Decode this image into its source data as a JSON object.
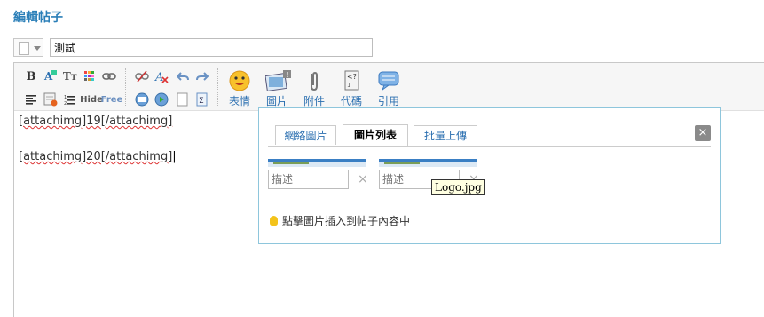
{
  "page": {
    "title": "編輯帖子"
  },
  "post": {
    "title_value": "測試"
  },
  "editor": {
    "lines": [
      "[attachimg]19[/attachimg]",
      "[attachimg]20[/attachimg]"
    ],
    "small_tools": {
      "hide": "Hide",
      "free": "Free",
      "bold": "B",
      "font_size": "Tт"
    },
    "big_tools": [
      {
        "label": "表情",
        "icon": "smiley-icon"
      },
      {
        "label": "圖片",
        "icon": "image-icon"
      },
      {
        "label": "附件",
        "icon": "paperclip-icon"
      },
      {
        "label": "代碼",
        "icon": "code-icon"
      },
      {
        "label": "引用",
        "icon": "quote-icon"
      }
    ]
  },
  "image_dialog": {
    "tabs": [
      "網絡圖片",
      "圖片列表",
      "批量上傳"
    ],
    "active_tab": "圖片列表",
    "close": "×",
    "desc_placeholder": "描述",
    "delete": "×",
    "tooltip": "Logo.jpg",
    "hint": "點擊圖片插入到帖子內容中"
  }
}
